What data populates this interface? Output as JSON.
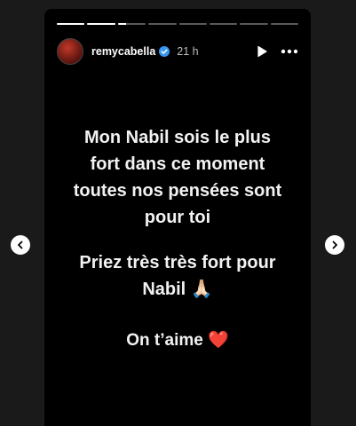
{
  "story": {
    "progress_segments": [
      1,
      1,
      0.3,
      0,
      0,
      0,
      0,
      0
    ],
    "user": {
      "username": "remycabella",
      "verified": true,
      "time_ago": "21 h"
    },
    "message": {
      "paragraph1": "Mon Nabil sois le plus fort dans ce moment toutes nos pensées sont pour toi",
      "paragraph2": "Priez très très fort pour Nabil",
      "paragraph2_emoji": "🙏🏻",
      "paragraph3": "On t’aime",
      "paragraph3_emoji": "❤️"
    }
  },
  "icons": {
    "avatar": "avatar",
    "verified": "verified-badge-icon",
    "play": "play-icon",
    "more": "more-options-icon",
    "prev": "chevron-left-icon",
    "next": "chevron-right-icon"
  },
  "colors": {
    "story_bg": "#000000",
    "page_bg": "#1a1a1a",
    "text": "#f2f2f2",
    "heart": "#e0245e",
    "verified": "#3897f0"
  }
}
